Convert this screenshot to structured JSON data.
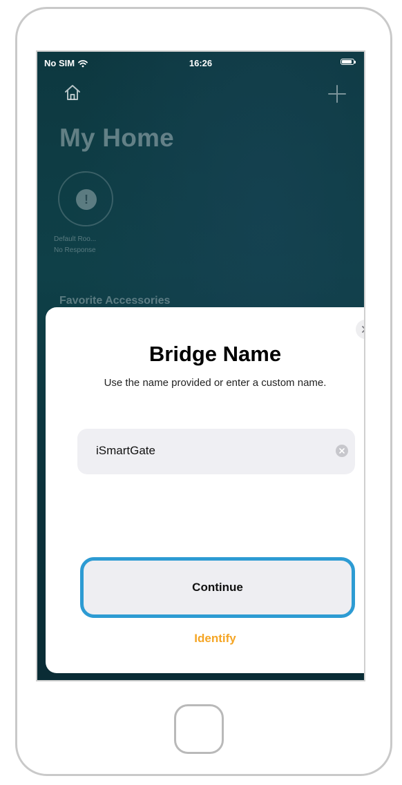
{
  "status_bar": {
    "carrier": "No SIM",
    "time": "16:26"
  },
  "home": {
    "title": "My Home",
    "room": {
      "name": "Default Roo...",
      "status": "No Response",
      "alert_glyph": "!"
    },
    "favorites_header": "Favorite Accessories",
    "icons": {
      "home": "house-icon",
      "add": "plus-icon"
    }
  },
  "dialog": {
    "title": "Bridge Name",
    "subtitle": "Use the name provided or enter a custom name.",
    "name_field_value": "iSmartGate",
    "continue_label": "Continue",
    "identify_label": "Identify"
  },
  "colors": {
    "accent_orange": "#f5a524",
    "highlight_blue": "#2d9bd3",
    "background_teal": "#0f4048"
  }
}
